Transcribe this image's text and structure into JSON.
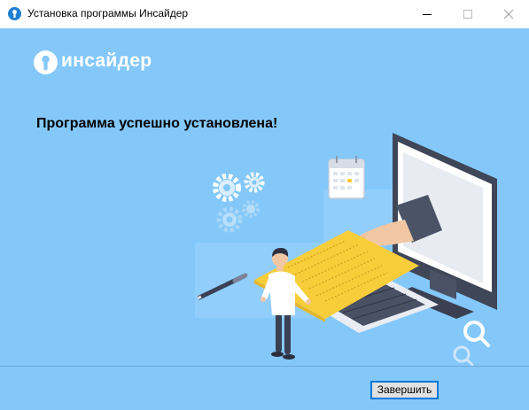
{
  "window": {
    "title": "Установка программы Инсайдер",
    "controls": [
      "minimize",
      "maximize",
      "close"
    ]
  },
  "logo": {
    "text": "инсайдер"
  },
  "heading": "Программа успешно установлена!",
  "footer": {
    "finish_label": "Завершить"
  },
  "colors": {
    "background": "#84c8fa",
    "titlebar": "#ffffff",
    "document": "#f7cd3a",
    "accent": "#0078d7"
  },
  "icons": {
    "app": "insider-app-icon",
    "minimize": "minimize-icon",
    "maximize": "maximize-icon",
    "close": "close-icon"
  }
}
